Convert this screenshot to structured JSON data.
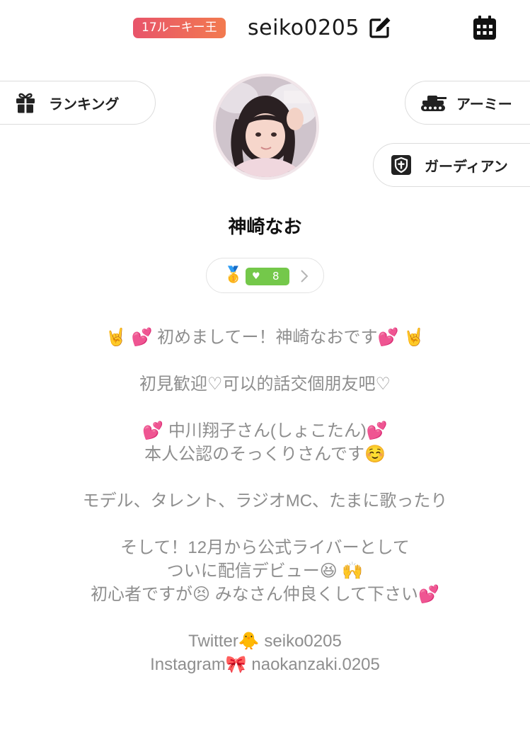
{
  "header": {
    "badge": "17ルーキー王",
    "username": "seiko0205",
    "icons": [
      "edit-icon",
      "calendar-icon"
    ]
  },
  "buttons": {
    "ranking": {
      "label": "ランキング",
      "icon": "gift-icon"
    },
    "army": {
      "label": "アーミー",
      "icon": "tank-icon"
    },
    "guardian": {
      "label": "ガーディアン",
      "icon": "shield-icon"
    }
  },
  "profile": {
    "display_name": "神崎なお",
    "fan_chip": {
      "rank_icon": "🥇",
      "heart": "♥",
      "like_count": "8"
    }
  },
  "bio": {
    "lines": [
      "🤘 💕 初めましてー！神崎なおです💕 🤘",
      "",
      "初見歓迎♡可以的話交個朋友吧♡",
      "",
      "💕 中川翔子さん(しょこたん)💕",
      "本人公認のそっくりさんです☺️",
      "",
      "モデル、タレント、ラジオMC、たまに歌ったり",
      "",
      "そして！12月から公式ライバーとして",
      "ついに配信デビュー😆 🙌",
      "初心者ですが😣 みなさん仲良くして下さい💕",
      "",
      "Twitter🐥 seiko0205",
      "Instagram🎀 naokanzaki.0205"
    ]
  },
  "colors": {
    "badge_start": "#e8546a",
    "badge_end": "#f27a4f",
    "like_green": "#74c84a",
    "bio_text": "#8e8e8e"
  }
}
